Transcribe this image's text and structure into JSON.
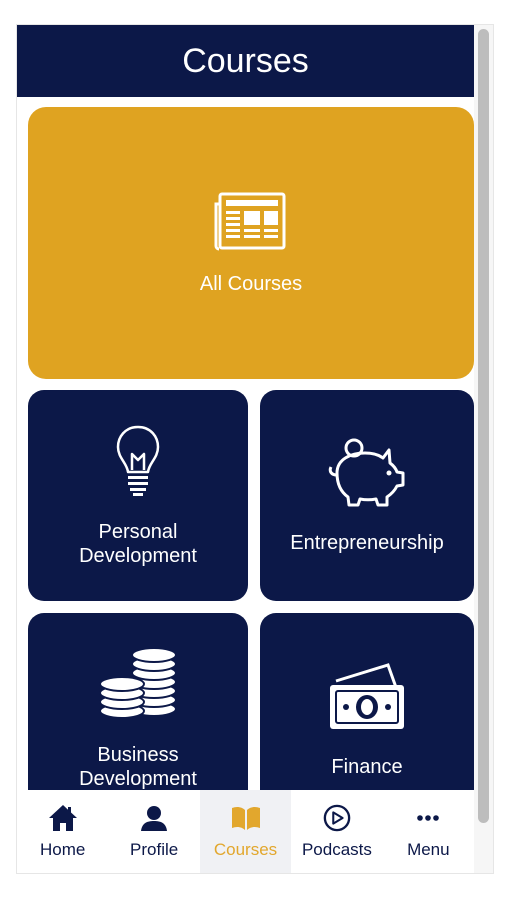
{
  "header": {
    "title": "Courses"
  },
  "tiles": [
    {
      "label": "All Courses",
      "icon": "newspaper-icon",
      "color": "#dfa321"
    },
    {
      "label": "Personal\nDevelopment",
      "icon": "lightbulb-icon",
      "color": "#0c1848"
    },
    {
      "label": "Entrepreneurship",
      "icon": "piggy-bank-icon",
      "color": "#0c1848"
    },
    {
      "label": "Business\nDevelopment",
      "icon": "coins-icon",
      "color": "#0c1848"
    },
    {
      "label": "Finance",
      "icon": "banknotes-icon",
      "color": "#0c1848"
    }
  ],
  "nav": {
    "items": [
      {
        "label": "Home",
        "icon": "home-icon",
        "active": false
      },
      {
        "label": "Profile",
        "icon": "user-icon",
        "active": false
      },
      {
        "label": "Courses",
        "icon": "open-book-icon",
        "active": true
      },
      {
        "label": "Podcasts",
        "icon": "play-circle-icon",
        "active": false
      },
      {
        "label": "Menu",
        "icon": "more-dots-icon",
        "active": false
      }
    ]
  },
  "colors": {
    "navy": "#0c1848",
    "gold": "#dfa321",
    "active_nav": "#e2a72d"
  }
}
